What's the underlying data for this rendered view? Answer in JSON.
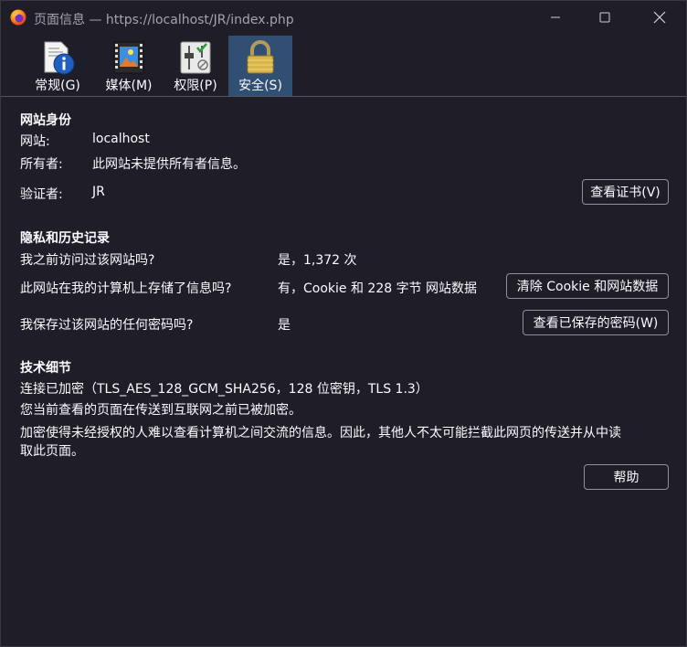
{
  "window": {
    "title": "页面信息 — https://localhost/JR/index.php"
  },
  "tabs": [
    {
      "label": "常规(G)"
    },
    {
      "label": "媒体(M)"
    },
    {
      "label": "权限(P)"
    },
    {
      "label": "安全(S)",
      "selected": true
    }
  ],
  "identity": {
    "heading": "网站身份",
    "site_label": "网站:",
    "site_value": "localhost",
    "owner_label": "所有者:",
    "owner_value": "此网站未提供所有者信息。",
    "verifier_label": "验证者:",
    "verifier_value": "JR",
    "view_cert_button": "查看证书(V)"
  },
  "privacy": {
    "heading": "隐私和历史记录",
    "q1": "我之前访问过该网站吗?",
    "a1": "是，1,372 次",
    "q2": "此网站在我的计算机上存储了信息吗?",
    "a2": "有，Cookie 和 228 字节 网站数据",
    "clear_button": "清除 Cookie 和网站数据",
    "q3": "我保存过该网站的任何密码吗?",
    "a3": "是",
    "view_passwords_button": "查看已保存的密码(W)"
  },
  "technical": {
    "heading": "技术细节",
    "line1": "连接已加密（TLS_AES_128_GCM_SHA256，128 位密钥，TLS 1.3）",
    "line2": "您当前查看的页面在传送到互联网之前已被加密。",
    "line3": "加密使得未经授权的人难以查看计算机之间交流的信息。因此，其他人不太可能拦截此网页的传送并从中读",
    "line4": "取此页面。",
    "help_button": "帮助"
  },
  "colors": {
    "background": "#1f1e28",
    "selected_tab": "#314f73",
    "button_border": "#8f8f9d"
  }
}
